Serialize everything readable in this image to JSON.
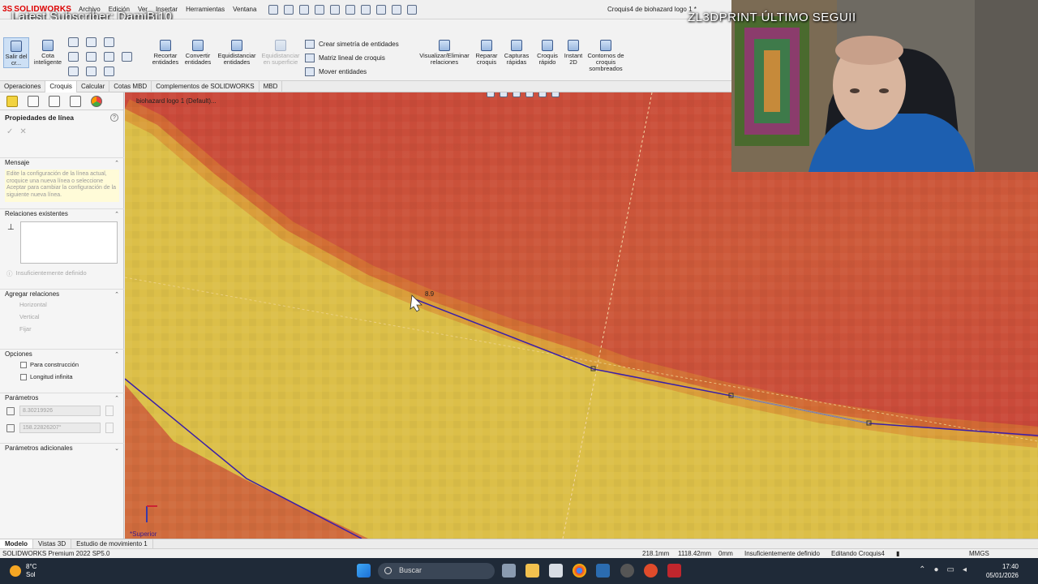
{
  "overlay": {
    "latest_subscriber": "Latest Subscriber: DamiBj10",
    "right_caption": "ZL3DPRINT   ÚLTIMO SEGUII"
  },
  "app": {
    "brand_ds": "3S",
    "brand_name": "SOLIDWORKS",
    "document_title": "Croquis4 de biohazard logo 1 *",
    "menus": [
      "Archivo",
      "Edición",
      "Ver",
      "Insertar",
      "Herramientas",
      "Ventana"
    ]
  },
  "command_manager": {
    "salir": "Salir del cr...",
    "cota": "Cota inteligente",
    "recortar": "Recortar entidades",
    "convertir": "Convertir entidades",
    "equidistanciar": "Equidistanciar entidades",
    "equidistanciar_sup": "Equidistanciar en superficie",
    "simetria": "Crear simetría de entidades",
    "matriz": "Matriz lineal de croquis",
    "mover": "Mover entidades",
    "visualizar": "Visualizar/Eliminar relaciones",
    "reparar": "Reparar croquis",
    "capturas": "Capturas rápidas",
    "croquis_rapido": "Croquis rápido",
    "instant2d": "Instant 2D",
    "contornos": "Contornos de croquis sombreados"
  },
  "tabs": [
    "Operaciones",
    "Croquis",
    "Calcular",
    "Cotas MBD",
    "Complementos de SOLIDWORKS",
    "MBD"
  ],
  "selected_tab": "Croquis",
  "panel": {
    "title": "Propiedades de línea",
    "help": "?",
    "ok": "✓",
    "cancel": "✕",
    "mensaje_title": "Mensaje",
    "mensaje_text": "Edite la configuración de la línea actual, croquice una nueva línea o seleccione Aceptar para cambiar la configuración de la siguiente nueva línea.",
    "relaciones_title": "Relaciones existentes",
    "status": "Insuficientemente definido",
    "agregar_title": "Agregar relaciones",
    "rel_horizontal": "Horizontal",
    "rel_vertical": "Vertical",
    "rel_fijar": "Fijar",
    "opciones_title": "Opciones",
    "opt_construccion": "Para construcción",
    "opt_infinita": "Longitud infinita",
    "parametros_title": "Parámetros",
    "param_length": "8.30219926",
    "param_angle": "158.22826207°",
    "adicionales_title": "Parámetros adicionales"
  },
  "viewport": {
    "tree_label": "biohazard logo 1  (Default)...",
    "dimension_label": "8.9",
    "view_label": "*Superior"
  },
  "model_tabs": [
    "Modelo",
    "Vistas 3D",
    "Estudio de movimiento 1"
  ],
  "status_bar": {
    "product": "SOLIDWORKS Premium 2022 SP5.0",
    "x": "218.1mm",
    "y": "1118.42mm",
    "z": "0mm",
    "state": "Insuficientemente definido",
    "editing": "Editando Croquis4",
    "units": "MMGS"
  },
  "taskbar": {
    "temp": "8°C",
    "weather": "Sol",
    "search_placeholder": "Buscar",
    "time": "17:40",
    "date": "05/01/2026"
  },
  "colors": {
    "sketch_line": "#3a1fa8",
    "red_region": "#c9473a",
    "yellow_region": "#dcc04a",
    "construction": "#f4d2a0"
  }
}
